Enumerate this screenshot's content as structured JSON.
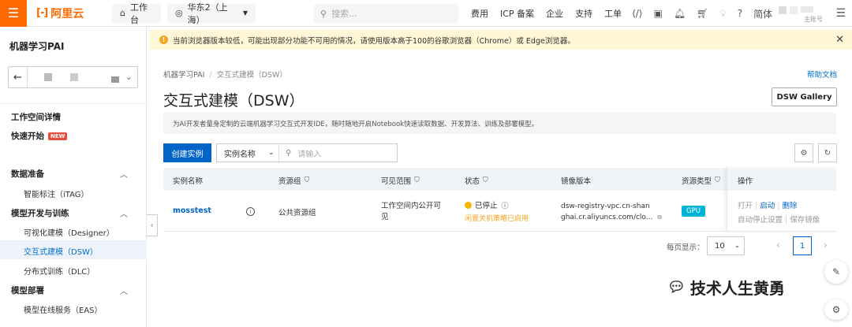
{
  "topbar": {
    "brand": "阿里云",
    "workbench": "工作台",
    "region": "华东2（上海）",
    "search_placeholder": "搜索...",
    "links": [
      "费用",
      "ICP 备案",
      "企业",
      "支持",
      "工单"
    ],
    "lang": "简体",
    "account_label": "主账号"
  },
  "notice": {
    "text": "当前浏览器版本较低，可能出现部分功能不可用的情况，请使用版本高于100的谷歌浏览器（Chrome）或 Edge浏览器。"
  },
  "sidebar": {
    "title": "机器学习PAI",
    "workspace_details": "工作空间详情",
    "quick_start": "快速开始",
    "new_badge": "NEW",
    "groups": [
      {
        "label": "数据准备",
        "items": [
          "智能标注（iTAG）"
        ]
      },
      {
        "label": "模型开发与训练",
        "items": [
          "可视化建模（Designer）",
          "交互式建模（DSW）",
          "分布式训练（DLC）"
        ]
      },
      {
        "label": "模型部署",
        "items": [
          "模型在线服务（EAS）"
        ]
      }
    ]
  },
  "breadcrumb": [
    "机器学习PAI",
    "交互式建模（DSW）"
  ],
  "help_link": "帮助文档",
  "page_title": "交互式建模（DSW）",
  "gallery_button": "DSW Gallery",
  "description": "为AI开发者量身定制的云端机器学习交互式开发IDE，随时随地开启Notebook快速读取数据、开发算法、训练及部署模型。",
  "toolbar": {
    "create_button": "创建实例",
    "filter_field": "实例名称",
    "search_placeholder": "请输入"
  },
  "table": {
    "headers": [
      "实例名称",
      "资源组",
      "可见范围",
      "状态",
      "镜像版本",
      "资源类型",
      "操作"
    ],
    "rows": [
      {
        "name": "mosstest",
        "resource_group": "公共资源组",
        "visibility": "工作空间内公开可见",
        "status": "已停止",
        "status_sub": "闲置关机策略已启用",
        "image_line1": "dsw-registry-vpc.cn-shan",
        "image_line2": "ghai.cr.aliyuncs.com/clo...",
        "resource_type": "GPU",
        "actions": [
          "打开",
          "启动",
          "删除"
        ],
        "actions_secondary": [
          "自动停止设置",
          "保存镜像"
        ]
      }
    ]
  },
  "pagination": {
    "page_size_label": "每页显示：",
    "page_size": "10",
    "current_page": "1"
  },
  "watermark": "技术人生黄勇"
}
